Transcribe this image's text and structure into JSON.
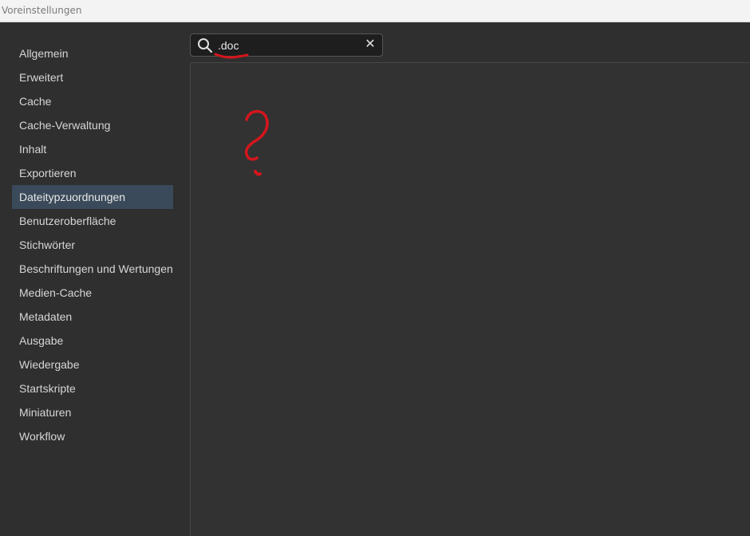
{
  "window": {
    "title": "Voreinstellungen"
  },
  "sidebar": {
    "items": [
      {
        "label": "Allgemein"
      },
      {
        "label": "Erweitert"
      },
      {
        "label": "Cache"
      },
      {
        "label": "Cache-Verwaltung"
      },
      {
        "label": "Inhalt"
      },
      {
        "label": "Exportieren"
      },
      {
        "label": "Dateitypzuordnungen"
      },
      {
        "label": "Benutzeroberfläche"
      },
      {
        "label": "Stichwörter"
      },
      {
        "label": "Beschriftungen und Wertungen"
      },
      {
        "label": "Medien-Cache"
      },
      {
        "label": "Metadaten"
      },
      {
        "label": "Ausgabe"
      },
      {
        "label": "Wiedergabe"
      },
      {
        "label": "Startskripte"
      },
      {
        "label": "Miniaturen"
      },
      {
        "label": "Workflow"
      }
    ],
    "selected": "Dateitypzuordnungen"
  },
  "search": {
    "value": ".doc",
    "clear_glyph": "✕",
    "icon": "search-icon"
  },
  "annotation": {
    "color": "#d4161c"
  },
  "colors": {
    "background": "#2f2f2f",
    "selected_item": "#3a4a5a",
    "titlebar": "#f3f3f3"
  }
}
